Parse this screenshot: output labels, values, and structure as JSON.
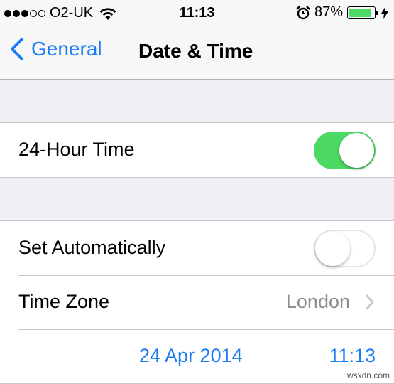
{
  "status_bar": {
    "carrier": "O2-UK",
    "signal_bars": 3,
    "signal_total": 5,
    "time": "11:13",
    "battery_percent": "87%",
    "battery_level": 0.87,
    "icons": [
      "signal-dots-icon",
      "wifi-icon",
      "alarm-clock-icon",
      "battery-icon",
      "charging-bolt-icon"
    ]
  },
  "nav": {
    "back_label": "General",
    "title": "Date & Time"
  },
  "settings": {
    "hour24": {
      "label": "24-Hour Time",
      "enabled": true
    },
    "set_auto": {
      "label": "Set Automatically",
      "enabled": false
    },
    "time_zone": {
      "label": "Time Zone",
      "value": "London"
    },
    "date_time": {
      "date": "24 Apr 2014",
      "time": "11:13"
    }
  },
  "colors": {
    "accent": "#1a7cf5",
    "toggle_on": "#4cd964",
    "background": "#efeff4"
  },
  "watermark": "wsxdn.com"
}
